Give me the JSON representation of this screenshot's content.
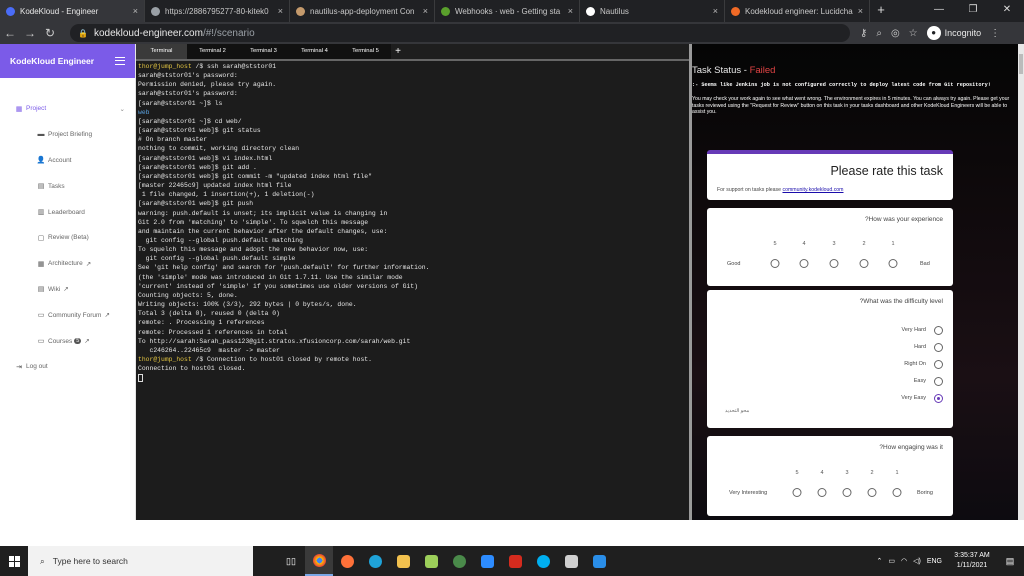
{
  "browser": {
    "tabs": [
      {
        "label": "KodeKloud - Engineer",
        "color": "#4a6cf7",
        "active": true
      },
      {
        "label": "https://2886795277-80-kitek0",
        "color": "#9aa0a6",
        "active": false
      },
      {
        "label": "nautilus-app-deployment Con",
        "color": "#c49a6c",
        "active": false
      },
      {
        "label": "Webhooks · web - Getting sta",
        "color": "#5aa02c",
        "active": false
      },
      {
        "label": "Nautilus",
        "color": "#ffffff",
        "active": false
      },
      {
        "label": "Kodekloud engineer: Lucidcha",
        "color": "#f06a26",
        "active": false
      }
    ],
    "new_tab": "+",
    "window_controls": {
      "minimize": "—",
      "maximize": "❐",
      "close": "✕"
    },
    "url_main": "kodekloud-engineer.com",
    "url_path": "/#!/scenario",
    "incognito_label": "Incognito"
  },
  "sidebar": {
    "brand": "KodeKloud Engineer",
    "project": "Project",
    "items": [
      {
        "label": "Project Briefing",
        "icon": "▬"
      },
      {
        "label": "Account",
        "icon": "👤"
      },
      {
        "label": "Tasks",
        "icon": "▤"
      },
      {
        "label": "Leaderboard",
        "icon": "▥"
      },
      {
        "label": "Review (Beta)",
        "icon": "▢"
      },
      {
        "label": "Architecture",
        "icon": "▦",
        "ext": "↗"
      },
      {
        "label": "Wiki",
        "icon": "▤",
        "ext": "↗"
      },
      {
        "label": "Community Forum",
        "icon": "▭",
        "ext": "↗"
      },
      {
        "label": "Courses",
        "icon": "▭",
        "badge": "5",
        "ext": "↗"
      }
    ],
    "logout": "Log out"
  },
  "terminal_tabs": [
    "Terminal",
    "Terminal 2",
    "Terminal 3",
    "Terminal 4",
    "Terminal 5"
  ],
  "terminal_plus": "+",
  "terminal_lines": [
    {
      "pre": "thor@jump_host",
      "text": " /$ ssh sarah@ststor01"
    },
    {
      "text": "sarah@ststor01's password:"
    },
    {
      "text": "Permission denied, please try again."
    },
    {
      "text": "sarah@ststor01's password:"
    },
    {
      "text": "[sarah@ststor01 ~]$ ls"
    },
    {
      "text": "web",
      "cls": "blue"
    },
    {
      "text": "[sarah@ststor01 ~]$ cd web/"
    },
    {
      "text": "[sarah@ststor01 web]$ git status"
    },
    {
      "text": "# On branch master"
    },
    {
      "text": "nothing to commit, working directory clean"
    },
    {
      "text": "[sarah@ststor01 web]$ vi index.html"
    },
    {
      "text": "[sarah@ststor01 web]$ git add ."
    },
    {
      "text": "[sarah@ststor01 web]$ git commit -m \"updated index html file\""
    },
    {
      "text": "[master 22465c9] updated index html file"
    },
    {
      "text": " 1 file changed, 1 insertion(+), 1 deletion(-)"
    },
    {
      "text": "[sarah@ststor01 web]$ git push"
    },
    {
      "text": "warning: push.default is unset; its implicit value is changing in"
    },
    {
      "text": "Git 2.0 from 'matching' to 'simple'. To squelch this message"
    },
    {
      "text": "and maintain the current behavior after the default changes, use:"
    },
    {
      "text": ""
    },
    {
      "text": "  git config --global push.default matching"
    },
    {
      "text": ""
    },
    {
      "text": "To squelch this message and adopt the new behavior now, use:"
    },
    {
      "text": ""
    },
    {
      "text": "  git config --global push.default simple"
    },
    {
      "text": ""
    },
    {
      "text": "See 'git help config' and search for 'push.default' for further information."
    },
    {
      "text": "(the 'simple' mode was introduced in Git 1.7.11. Use the similar mode"
    },
    {
      "text": "'current' instead of 'simple' if you sometimes use older versions of Git)"
    },
    {
      "text": ""
    },
    {
      "text": "Counting objects: 5, done."
    },
    {
      "text": "Writing objects: 100% (3/3), 292 bytes | 0 bytes/s, done."
    },
    {
      "text": "Total 3 (delta 0), reused 0 (delta 0)"
    },
    {
      "text": "remote: . Processing 1 references"
    },
    {
      "text": "remote: Processed 1 references in total"
    },
    {
      "text": "To http://sarah:Sarah_pass123@git.stratos.xfusioncorp.com/sarah/web.git"
    },
    {
      "text": "   c246264..22465c9  master -> master"
    },
    {
      "pre": "thor@jump_host",
      "text": " /$ Connection to host01 closed by remote host."
    },
    {
      "text": "Connection to host01 closed."
    }
  ],
  "task_status": {
    "label": "Task Status - ",
    "state": "Failed",
    "error": ":- Seems like Jenkins job is not configured correctly to deploy latest code from Git repository!",
    "note": "You may check your work again to see what went wrong. The environment expires in 5 minutes. You can always try again. Please get your tasks reviewed using the \"Request for Review\" button on this task in your tasks dashboard and other KodeKloud Engineers will be able to assist you."
  },
  "rating": {
    "title": "Please rate this task",
    "support_text": "For support on tasks please",
    "support_link": "community.kodekloud.com",
    "q1": {
      "title": "?How was your experience",
      "scale": [
        "5",
        "4",
        "3",
        "2",
        "1"
      ],
      "low": "Good",
      "high": "Bad"
    },
    "q2": {
      "title": "?What was the difficulty level",
      "options": [
        "Very Hard",
        "Hard",
        "Right On",
        "Easy",
        "Very Easy"
      ],
      "selected": "Very Easy",
      "rtl_label": "محو التحديد"
    },
    "q3": {
      "title": "?How engaging was it",
      "scale": [
        "5",
        "4",
        "3",
        "2",
        "1"
      ],
      "low": "Very Interesting",
      "high": "Boring"
    }
  },
  "taskbar": {
    "search_placeholder": "Type here to search",
    "lang": "ENG",
    "time": "3:35:37 AM",
    "date": "1/11/2021"
  }
}
